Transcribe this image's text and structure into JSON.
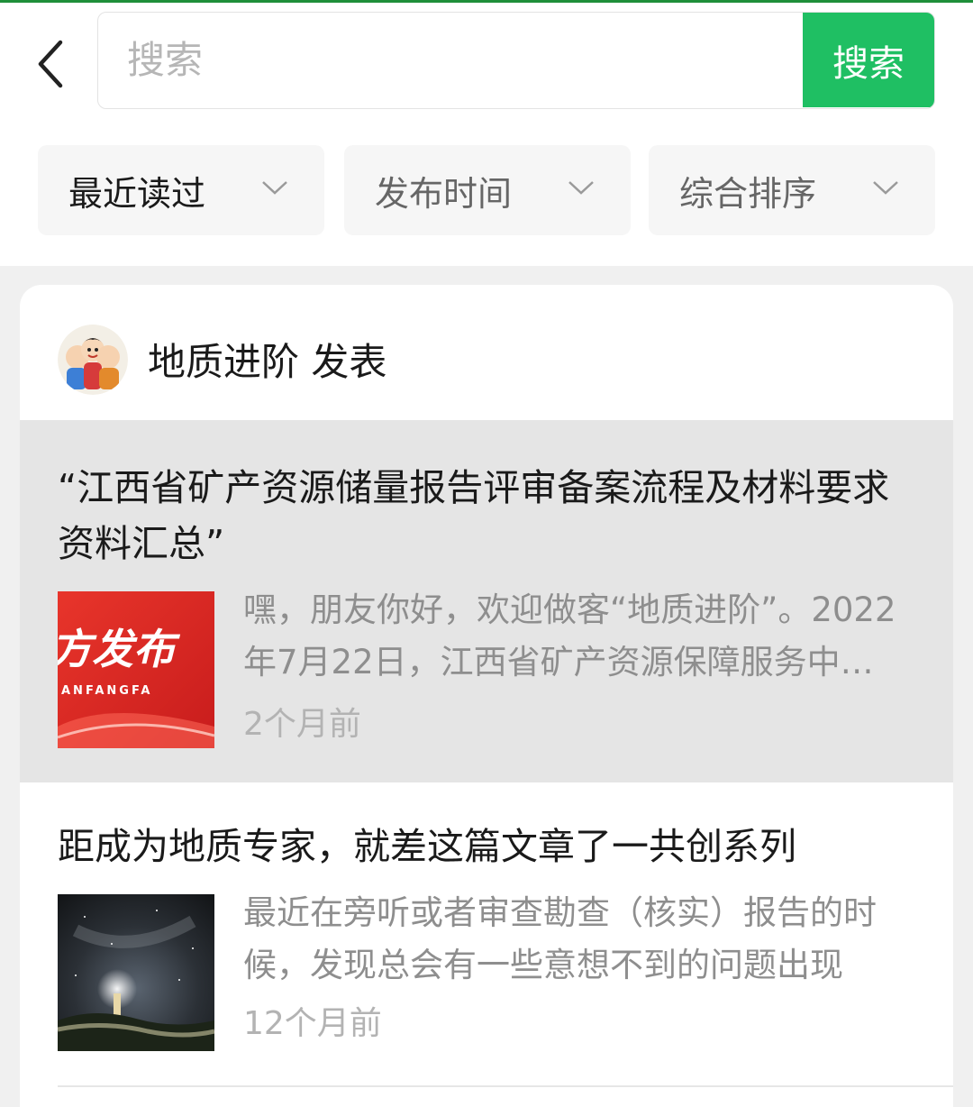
{
  "search": {
    "placeholder": "搜索",
    "button_label": "搜索"
  },
  "filters": [
    {
      "label": "最近读过"
    },
    {
      "label": "发布时间"
    },
    {
      "label": "综合排序"
    }
  ],
  "author": {
    "name": "地质进阶 发表",
    "avatar": "cartoon-avatar"
  },
  "articles": [
    {
      "title": "“江西省矿产资源储量报告评审备案流程及材料要求资料汇总”",
      "summary": "嘿，朋友你好，欢迎做客“地质进阶”。2022年7月22日，江西省矿产资源保障服务中心发布了相关内容",
      "time": "2个月前",
      "thumb_text": "方发布",
      "thumb_subtext": "ANFANGFA",
      "highlighted": true
    },
    {
      "title": "距成为地质专家，就差这篇文章了一共创系列",
      "summary": "最近在旁听或者审查勘查（核实）报告的时候，发现总会有一些意想不到的问题出现",
      "time": "12个月前",
      "highlighted": false
    }
  ],
  "colors": {
    "accent": "#1fbf63",
    "top_line": "#1f8f3a",
    "highlight_bg": "#e5e5e5",
    "page_bg": "#f0f0f0"
  }
}
